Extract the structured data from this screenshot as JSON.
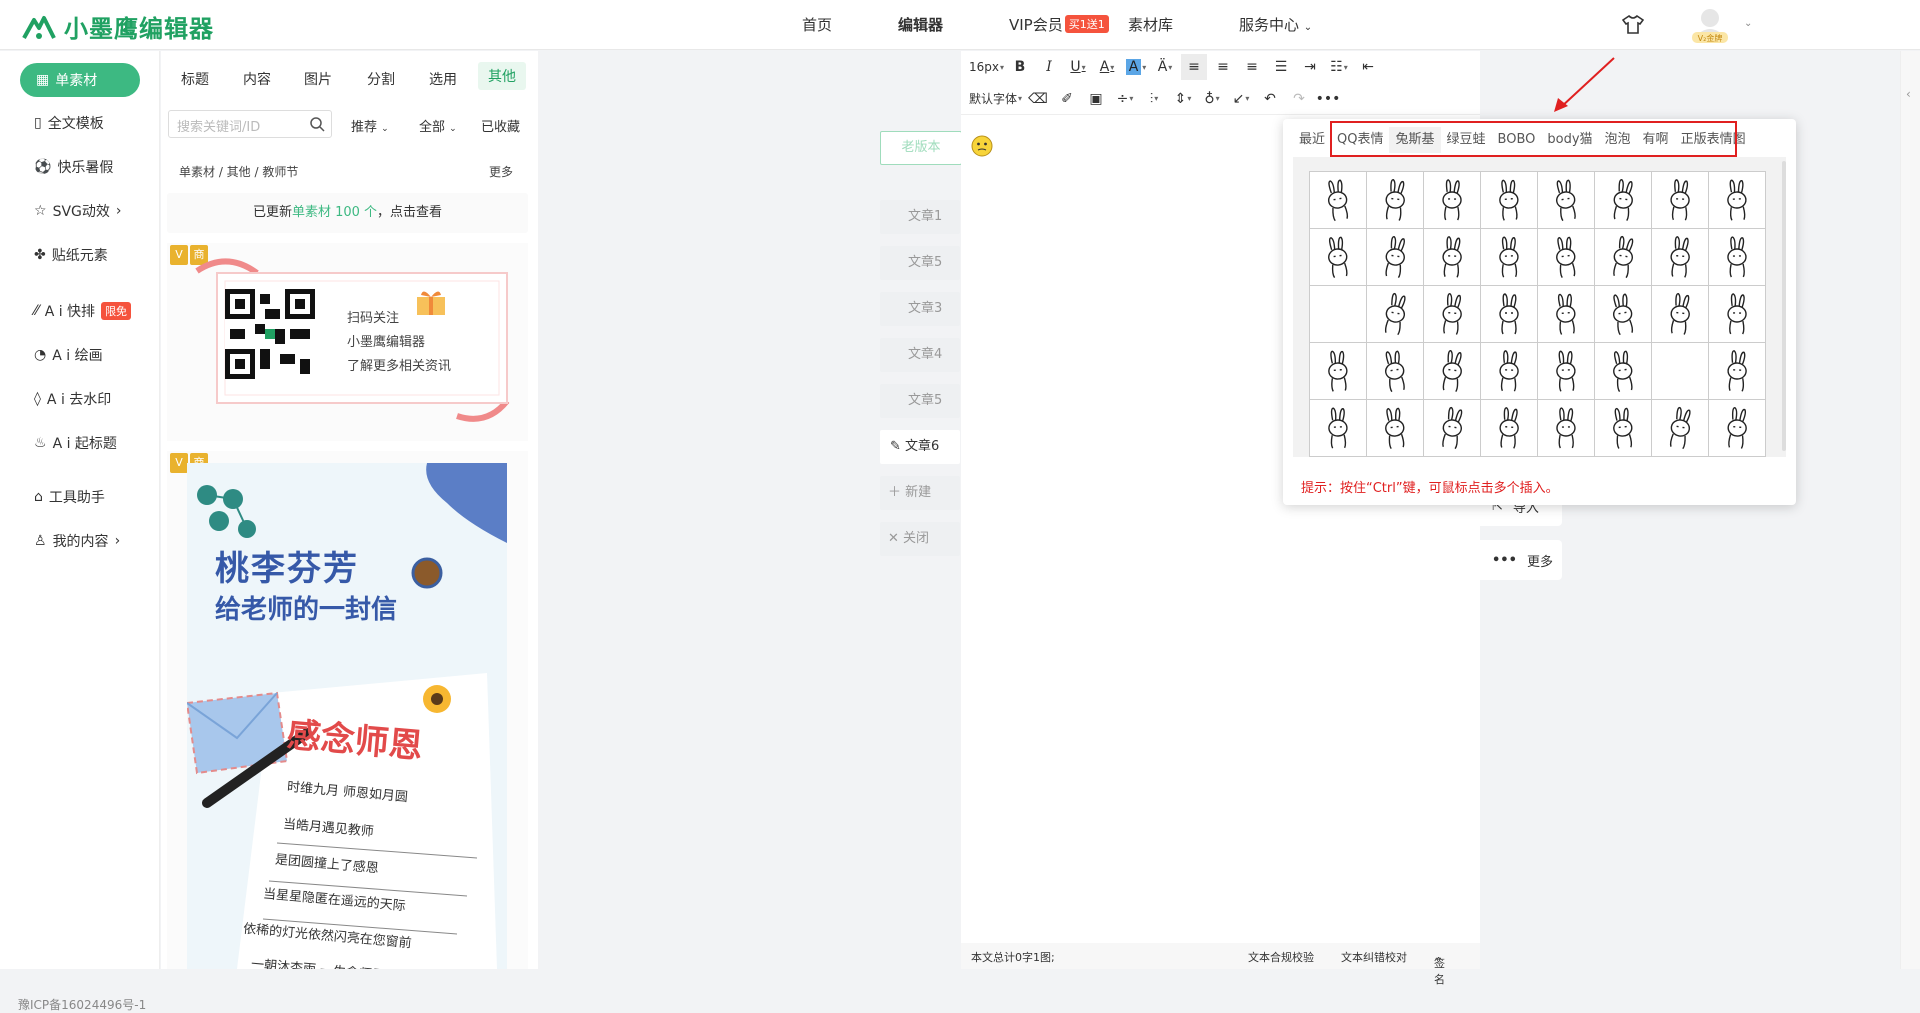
{
  "header": {
    "brand": "小墨鹰编辑器",
    "nav": [
      {
        "label": "首页"
      },
      {
        "label": "编辑器"
      },
      {
        "label": "VIP会员",
        "badge": "买1送1"
      },
      {
        "label": "素材库"
      },
      {
        "label": "服务中心"
      }
    ],
    "user_level": "V₂金牌"
  },
  "sidebar": {
    "items": [
      {
        "label": "单素材"
      },
      {
        "label": "全文模板"
      },
      {
        "label": "快乐暑假"
      },
      {
        "label": "SVG动效"
      },
      {
        "label": "贴纸元素"
      },
      {
        "label": "A i 快排",
        "badge": "限免"
      },
      {
        "label": "A i 绘画"
      },
      {
        "label": "A i 去水印"
      },
      {
        "label": "A i 起标题"
      },
      {
        "label": "工具助手"
      },
      {
        "label": "我的内容"
      }
    ],
    "icp": "豫ICP备16024496号-1"
  },
  "materials": {
    "categories": [
      "标题",
      "内容",
      "图片",
      "分割",
      "选用",
      "其他"
    ],
    "search_placeholder": "搜索关键词/ID",
    "filters": [
      "推荐",
      "全部",
      "已收藏"
    ],
    "breadcrumb": "单素材 / 其他 / 教师节",
    "more": "更多",
    "update_pre": "已更新",
    "update_highlight": "单素材 100 个",
    "update_post": "，点击查看",
    "badges": [
      "V",
      "商"
    ],
    "card1": {
      "line1": "扫码关注",
      "line2": "小墨鹰编辑器",
      "line3": "了解更多相关资讯"
    },
    "card2": {
      "title1": "桃李芬芳",
      "title2": "给老师的一封信",
      "title3": "感念师恩",
      "lines": [
        "时维九月 师恩如月圆",
        "当皓月遇见教师",
        "是团圆撞上了感恩",
        "当星星隐匿在遥远的天际",
        "依稀的灯光依然闪亮在您窗前",
        "一朝沐杏雨 一生念师恩"
      ]
    }
  },
  "articles": {
    "old_version": "老版本",
    "list": [
      "文章1",
      "文章5",
      "文章3",
      "文章4",
      "文章5",
      "文章6"
    ],
    "new": "新建",
    "close": "关闭"
  },
  "editor": {
    "font_size": "16px",
    "font_family": "默认字体",
    "status_count": "本文总计0字1图;",
    "status_check1": "文本合规校验",
    "status_check2": "文本纠错校对",
    "status_sign": "签名"
  },
  "right_buttons": {
    "import": "导入",
    "more": "更多"
  },
  "emoji_popup": {
    "tabs": [
      "最近",
      "QQ表情",
      "兔斯基",
      "绿豆蛙",
      "BOBO",
      "body猫",
      "泡泡",
      "有啊",
      "正版表情图"
    ],
    "selected_tab": "兔斯基",
    "tip": "提示：按住“Ctrl”键，可鼠标点击多个插入。"
  },
  "colors": {
    "brand": "#20a162",
    "accent": "#3db982",
    "alert": "#e02020"
  }
}
